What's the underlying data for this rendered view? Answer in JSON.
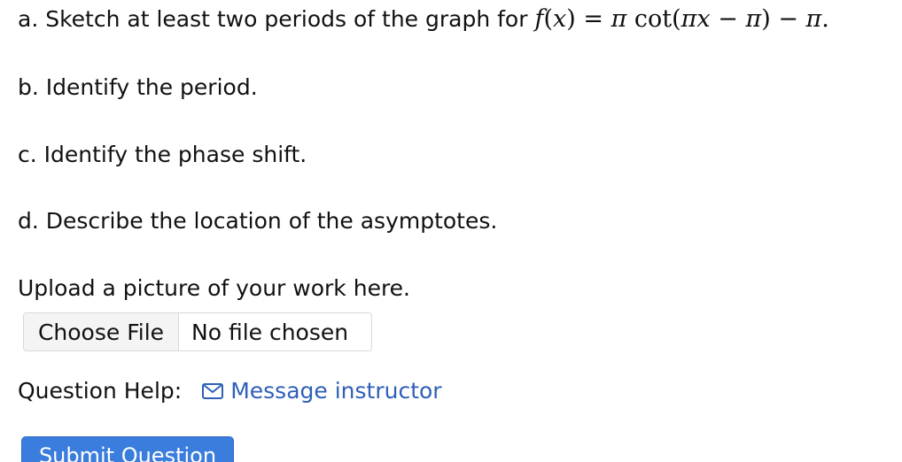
{
  "questions": {
    "a_text": "a. Sketch at least two periods of the graph for",
    "a_math": {
      "f": "f",
      "lparen": "(",
      "x": "x",
      "rparen_eq": ") = ",
      "pi1": "π",
      "cot": " cot(",
      "pi2": "π",
      "x2": "x",
      "minus1": " − ",
      "pi3": "π",
      "close": ") − ",
      "pi4": "π",
      "period": "."
    },
    "b": "b. Identify the period.",
    "c": "c. Identify the phase shift.",
    "d": "d. Describe the location of the asymptotes."
  },
  "upload": {
    "label": "Upload a picture of your work here.",
    "choose_button": "Choose File",
    "status": "No file chosen"
  },
  "help": {
    "label": "Question Help:",
    "message_link": "Message instructor",
    "icon": "envelope-icon"
  },
  "submit": {
    "label": "Submit Question"
  },
  "colors": {
    "link": "#2f5fb8",
    "submit_bg": "#3b7ddd",
    "text": "#111111"
  }
}
